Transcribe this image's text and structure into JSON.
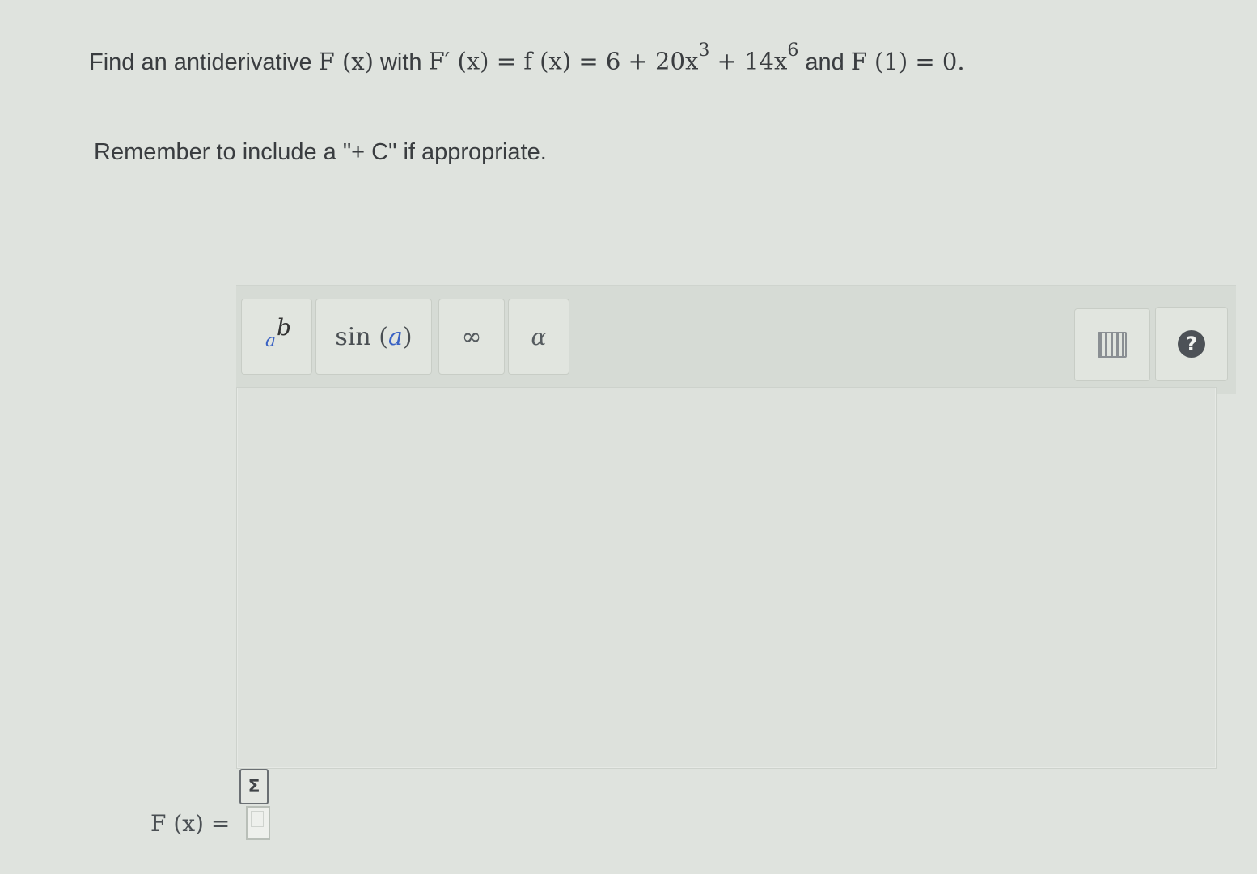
{
  "question": {
    "prefix": "Find an antiderivative",
    "fx": "F (x)",
    "with": "with",
    "deriv_lhs": "F′ (x) = f (x) = 6 + 20x",
    "exp1": "3",
    "plus": "+ 14x",
    "exp2": "6",
    "and": "and",
    "condition": "F (1) = 0."
  },
  "reminder": "Remember to include a \"+ C\" if appropriate.",
  "toolbar": {
    "power_base": "a",
    "power_exp": "b",
    "sin_func": "sin",
    "sin_arg": "a",
    "infinity": "∞",
    "alpha": "α",
    "help": "?"
  },
  "answer": {
    "label": "F (x) ="
  },
  "icons": {
    "keyboard": "keyboard-icon",
    "help": "help-icon",
    "sigma": "sigma-icon"
  }
}
